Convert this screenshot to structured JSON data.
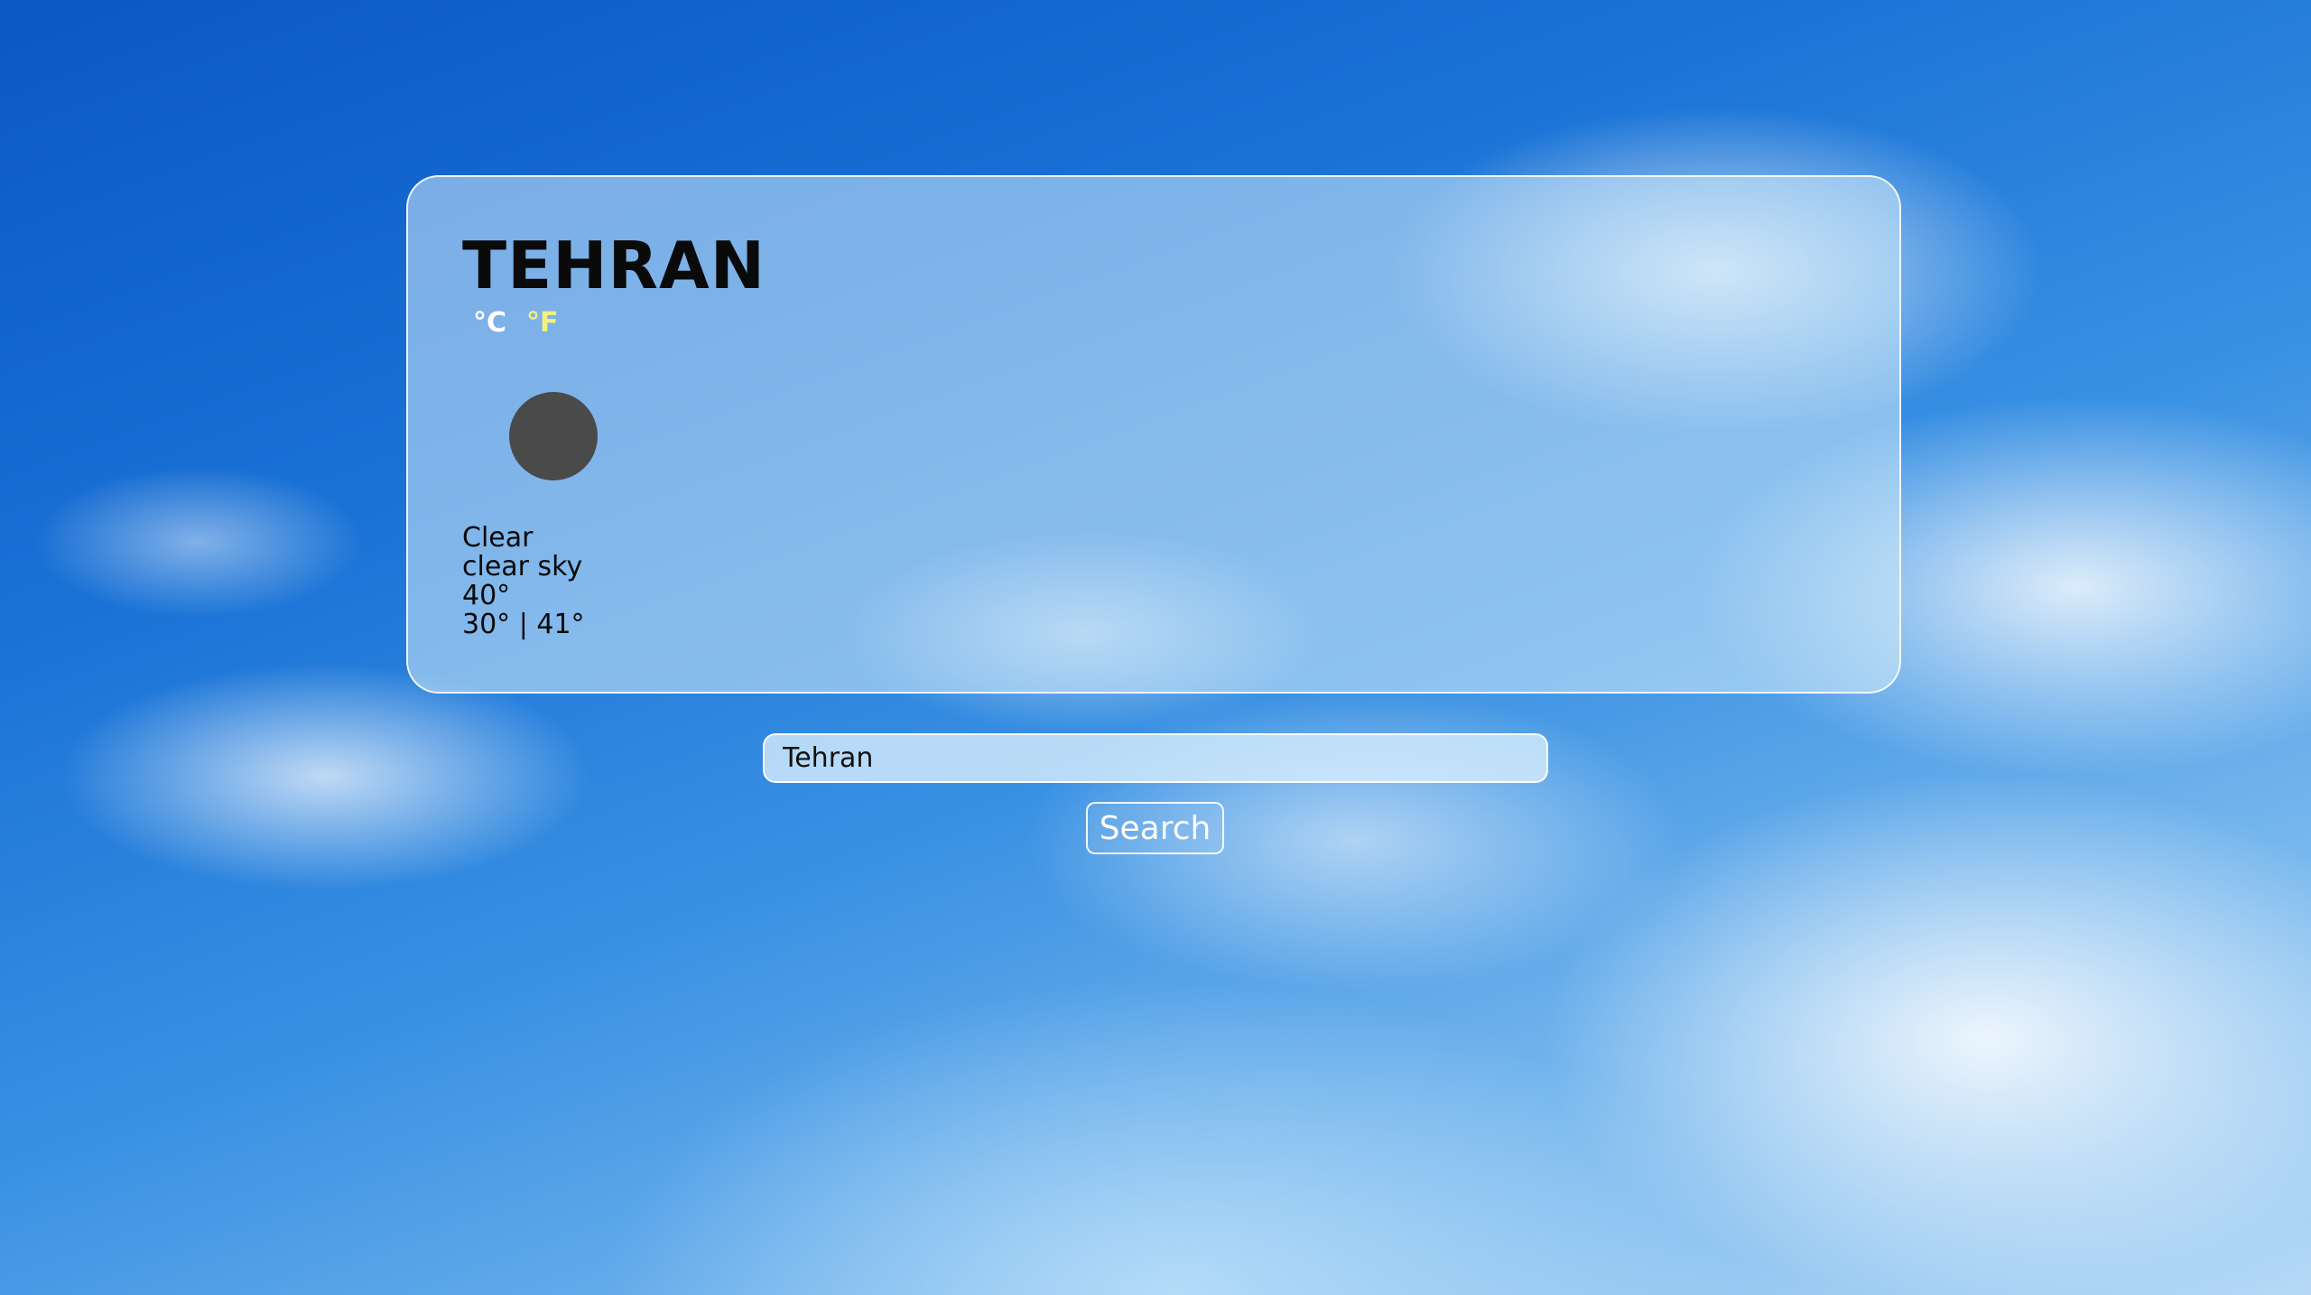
{
  "weather": {
    "city": "TEHRAN",
    "units": {
      "celsius": "°C",
      "fahrenheit": "°F",
      "active": "fahrenheit"
    },
    "icon": "weather-icon",
    "main": "Clear",
    "description": "clear sky",
    "temperature": "40°",
    "min_max": "30° | 41°"
  },
  "search": {
    "value": "Tehran",
    "button_label": "Search"
  },
  "colors": {
    "unit_active": "#f3f27a",
    "unit_inactive": "#ffffff",
    "icon_fill": "#4a4a4a"
  }
}
